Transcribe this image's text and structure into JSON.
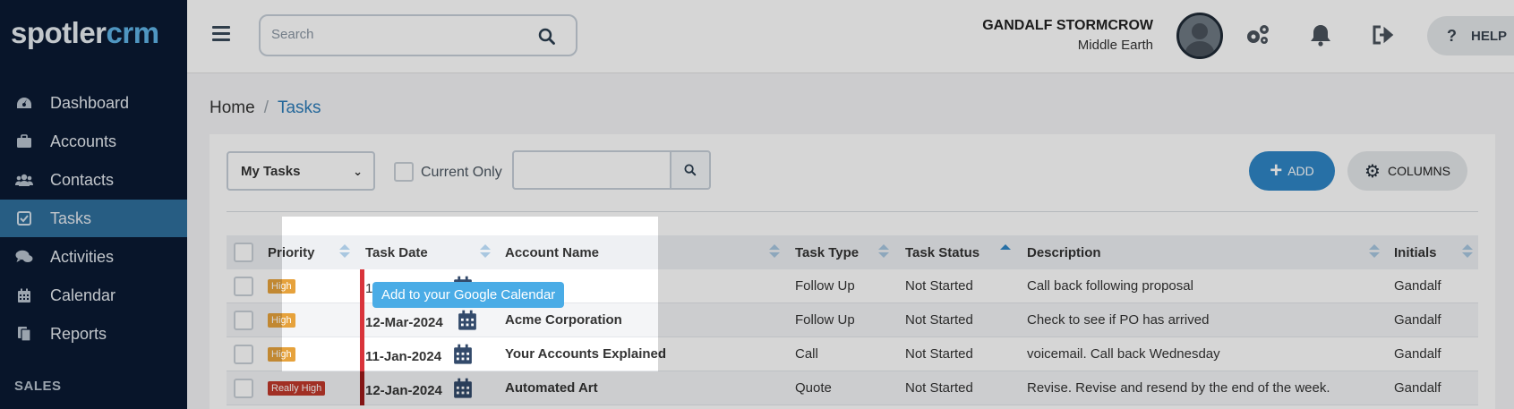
{
  "app": {
    "logo_part1": "spotler",
    "logo_part2": "crm"
  },
  "sidebar": {
    "items": [
      {
        "label": "Dashboard",
        "icon": "dashboard-icon"
      },
      {
        "label": "Accounts",
        "icon": "briefcase-icon"
      },
      {
        "label": "Contacts",
        "icon": "users-icon"
      },
      {
        "label": "Tasks",
        "icon": "checkbox-icon",
        "active": true
      },
      {
        "label": "Activities",
        "icon": "comments-icon"
      },
      {
        "label": "Calendar",
        "icon": "calendar-icon"
      },
      {
        "label": "Reports",
        "icon": "copy-icon"
      }
    ],
    "section": "SALES"
  },
  "header": {
    "search_placeholder": "Search",
    "user_name": "GANDALF STORMCROW",
    "user_location": "Middle Earth",
    "help_label": "HELP"
  },
  "breadcrumb": {
    "home": "Home",
    "current": "Tasks"
  },
  "filters": {
    "select_value": "My Tasks",
    "current_only_label": "Current Only",
    "add_label": "ADD",
    "columns_label": "COLUMNS"
  },
  "table": {
    "headers": [
      "Priority",
      "Task Date",
      "Account Name",
      "Task Type",
      "Task Status",
      "Description",
      "Initials"
    ],
    "rows": [
      {
        "priority": "High",
        "date": "1",
        "account": "",
        "type": "Follow Up",
        "status": "Not Started",
        "description": "Call back following proposal",
        "initials": "Gandalf"
      },
      {
        "priority": "High",
        "date": "12-Mar-2024",
        "account": "Acme Corporation",
        "type": "Follow Up",
        "status": "Not Started",
        "description": "Check to see if PO has arrived",
        "initials": "Gandalf"
      },
      {
        "priority": "High",
        "date": "11-Jan-2024",
        "account": "Your Accounts Explained",
        "type": "Call",
        "status": "Not Started",
        "description": "voicemail. Call back Wednesday",
        "initials": "Gandalf"
      },
      {
        "priority": "Really High",
        "date": "12-Jan-2024",
        "account": "Automated Art",
        "type": "Quote",
        "status": "Not Started",
        "description": "Revise. Revise and resend by the end of the week.",
        "initials": "Gandalf"
      }
    ]
  },
  "tooltip": {
    "text": "Add to your Google Calendar"
  },
  "colors": {
    "sidebar_bg": "#0a1a33",
    "accent": "#2f86c6",
    "active_nav": "#2f6f9d",
    "badge_high": "#e6a23c",
    "badge_really_high": "#c0392b"
  }
}
